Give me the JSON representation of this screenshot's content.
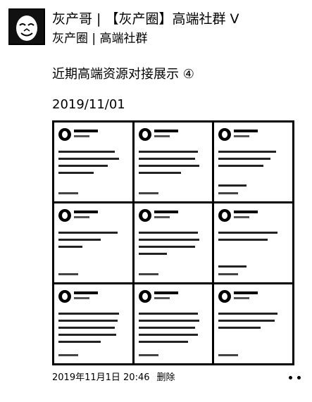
{
  "post": {
    "author": "灰产哥 | 【灰产圈】高端社群 V",
    "subtitle": "灰产圈 | 高端社群",
    "title": "近期高端资源对接展示 ④",
    "date": "2019/11/01",
    "thumb_count": 9,
    "footer_time": "2019年11月1日 20:46",
    "delete_label": "删除",
    "more_icon": "more-dots-icon"
  }
}
